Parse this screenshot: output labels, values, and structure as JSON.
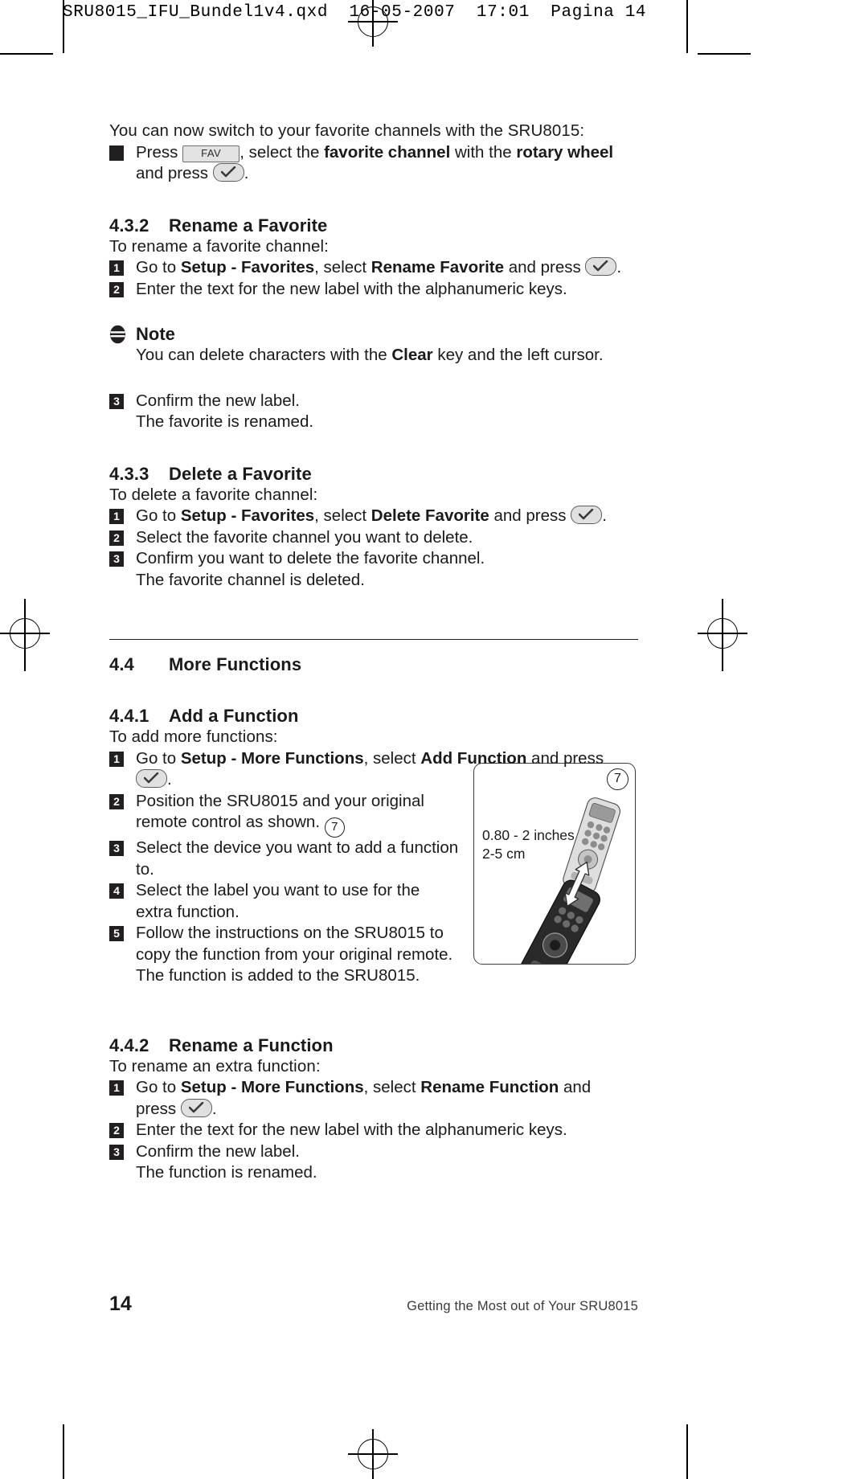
{
  "slug": "SRU8015_IFU_Bundel1v4.qxd  16-05-2007  17:01  Pagina 14",
  "intro": {
    "lead": "You can now switch to your favorite channels with the SRU8015:",
    "bullet_pre": "Press",
    "key_fav": "FAV",
    "bullet_mid": ", select the",
    "bold_1": "favorite channel",
    "bullet_mid2": "with the",
    "bold_2": "rotary wheel",
    "bullet_tail": "and press",
    "bullet_end": "."
  },
  "sections": [
    {
      "id": "4.3.2",
      "number": "4.3.2",
      "title": "Rename a Favorite",
      "intro": "To rename a favorite channel:",
      "steps": [
        {
          "num": "1",
          "parts": [
            {
              "t": "Go to ",
              "b": false
            },
            {
              "t": "Setup - Favorites",
              "b": true
            },
            {
              "t": ", select ",
              "b": false
            },
            {
              "t": "Rename Favorite",
              "b": true
            },
            {
              "t": " and press ",
              "b": false
            }
          ],
          "ok_key": true,
          "tail": "."
        },
        {
          "num": "2",
          "parts": [
            {
              "t": "Enter the text for the new label with the alphanumeric keys.",
              "b": false
            }
          ],
          "ok_key": false,
          "tail": ""
        }
      ],
      "note": {
        "title": "Note",
        "parts": [
          {
            "t": "You can delete characters with the ",
            "b": false
          },
          {
            "t": "Clear",
            "b": true
          },
          {
            "t": " key and the left cursor.",
            "b": false
          }
        ]
      },
      "steps_after": [
        {
          "num": "3",
          "parts": [
            {
              "t": "Confirm the new label.",
              "b": false
            }
          ],
          "ok_key": false,
          "tail": "",
          "cont": "The favorite is renamed."
        }
      ]
    },
    {
      "id": "4.3.3",
      "number": "4.3.3",
      "title": "Delete a Favorite",
      "intro": "To delete a favorite channel:",
      "steps": [
        {
          "num": "1",
          "parts": [
            {
              "t": "Go to ",
              "b": false
            },
            {
              "t": "Setup - Favorites",
              "b": true
            },
            {
              "t": ", select ",
              "b": false
            },
            {
              "t": "Delete Favorite",
              "b": true
            },
            {
              "t": " and press ",
              "b": false
            }
          ],
          "ok_key": true,
          "tail": "."
        },
        {
          "num": "2",
          "parts": [
            {
              "t": "Select the favorite channel you want to delete.",
              "b": false
            }
          ],
          "ok_key": false,
          "tail": ""
        },
        {
          "num": "3",
          "parts": [
            {
              "t": "Confirm you want to delete the favorite channel.",
              "b": false
            }
          ],
          "ok_key": false,
          "tail": "",
          "cont": "The favorite channel is deleted."
        }
      ]
    }
  ],
  "major": {
    "number": "4.4",
    "title": "More Functions"
  },
  "add_function": {
    "number": "4.4.1",
    "title": "Add a Function",
    "intro": "To add more functions:",
    "step1_a": "Go to ",
    "step1_b1": "Setup - More Functions",
    "step1_c": ", select ",
    "step1_b2": "Add Function",
    "step1_d": " and press",
    "step1_tail": ".",
    "step2_l1": "Position the SRU8015 and your original",
    "step2_l2": "remote control as shown.",
    "step2_callout": "7",
    "step3_l1": "Select the device you want to add a function",
    "step3_l2": "to.",
    "step4_l1": "Select the label you want to use for the",
    "step4_l2": "extra function.",
    "step5_l1": "Follow the instructions on the SRU8015 to",
    "step5_l2": "copy the function from your original remote.",
    "step5_l3": "The function is added to the SRU8015."
  },
  "illustration": {
    "callout": "7",
    "dim_inches": "0.80 - 2 inches",
    "dim_cm": "2-5 cm"
  },
  "rename_function": {
    "number": "4.4.2",
    "title": "Rename a Function",
    "intro": "To rename an extra function:",
    "step1_a": "Go to ",
    "step1_b1": "Setup - More Functions",
    "step1_c": ", select ",
    "step1_b2": "Rename Function",
    "step1_d": " and",
    "step1_cont": "press",
    "step1_tail": ".",
    "step2": "Enter the text for the new label with the alphanumeric keys.",
    "step3": "Confirm the new label.",
    "step3_cont": "The function is renamed."
  },
  "footer": {
    "page_number": "14",
    "running_head": "Getting the Most out of Your SRU8015"
  },
  "colors": {
    "ink": "#231f20",
    "key_fill": "#e0e0e0",
    "key_stroke": "#5d5d5d"
  }
}
